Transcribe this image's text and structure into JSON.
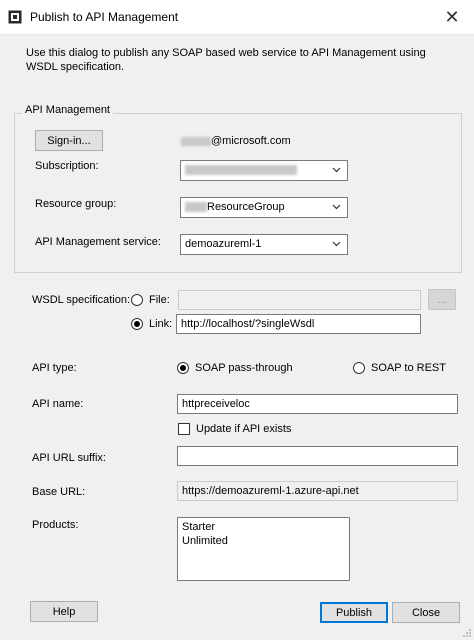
{
  "window": {
    "title": "Publish to API Management",
    "close_glyph": "✕",
    "icons": {
      "app": "api-management-app-icon",
      "close": "close-icon",
      "grip": "resize-grip-icon"
    }
  },
  "description": "Use this dialog to publish any SOAP based web service to API Management using WSDL specification.",
  "api_management_group": {
    "legend": "API Management",
    "signin_label": "Sign-in...",
    "account_suffix": "@microsoft.com",
    "subscription": {
      "label": "Subscription:",
      "value": ""
    },
    "resource_group": {
      "label": "Resource group:",
      "value": "ResourceGroup"
    },
    "service": {
      "label": "API Management service:",
      "value": "demoazureml-1"
    }
  },
  "wsdl": {
    "label": "WSDL specification:",
    "file_label": "File:",
    "file_value": "",
    "browse_label": "...",
    "link_label": "Link:",
    "link_value": "http://localhost/?singleWsdl",
    "selected": "Link"
  },
  "api_type": {
    "label": "API type:",
    "options": [
      "SOAP pass-through",
      "SOAP to REST"
    ],
    "selected": "SOAP pass-through"
  },
  "api_name": {
    "label": "API name:",
    "value": "httpreceiveloc"
  },
  "update_existing": {
    "label": "Update if API exists",
    "checked": false
  },
  "api_url_suffix": {
    "label": "API URL suffix:",
    "value": ""
  },
  "base_url": {
    "label": "Base URL:",
    "value": "https://demoazureml-1.azure-api.net"
  },
  "products": {
    "label": "Products:",
    "items": [
      "Starter",
      "Unlimited"
    ]
  },
  "buttons": {
    "help": "Help",
    "publish": "Publish",
    "close": "Close"
  },
  "colors": {
    "accent": "#0078d7",
    "dialog_bg": "#f0f0f0",
    "titlebar_bg": "#ffffff"
  }
}
